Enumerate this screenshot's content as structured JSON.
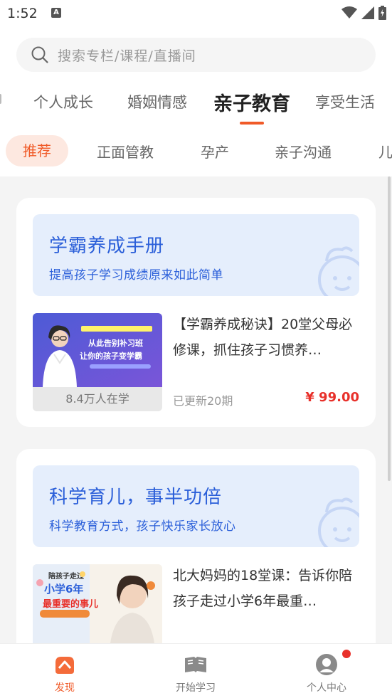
{
  "status_bar": {
    "time": "1:52",
    "indicator": "A"
  },
  "search": {
    "placeholder": "搜索专栏/课程/直播间"
  },
  "tabs": [
    {
      "label": "个人成长"
    },
    {
      "label": "婚姻情感"
    },
    {
      "label": "亲子教育"
    },
    {
      "label": "享受生活"
    }
  ],
  "subtabs": [
    {
      "label": "推荐"
    },
    {
      "label": "正面管教"
    },
    {
      "label": "孕产"
    },
    {
      "label": "亲子沟通"
    },
    {
      "label": "儿"
    }
  ],
  "cards": [
    {
      "banner_title": "学霸养成手册",
      "banner_subtitle": "提高孩子学习成绩原来如此简单",
      "course": {
        "title": "【学霸养成秘诀】20堂父母必修课，抓住孩子习惯养…",
        "learners": "8.4万人在学",
        "meta": "已更新20期",
        "price": "¥ 99.00",
        "thumb_headline": "从此告别补习班 让你的孩子变学霸"
      }
    },
    {
      "banner_title": "科学育儿，事半功倍",
      "banner_subtitle": "科学教育方式，孩子快乐家长放心",
      "course": {
        "title": "北大妈妈的18堂课：告诉你陪孩子走过小学6年最重…",
        "thumb_headline": "陪孩子走过 小学6年 最重要的事儿",
        "thumb_tag": "北大妈妈的18堂课"
      }
    }
  ],
  "bottom_nav": [
    {
      "label": "发现",
      "icon": "discover-icon",
      "active": true
    },
    {
      "label": "开始学习",
      "icon": "book-icon",
      "active": false
    },
    {
      "label": "个人中心",
      "icon": "profile-icon",
      "active": false
    }
  ],
  "colors": {
    "accent": "#f05a28",
    "price": "#e8312b",
    "banner_text": "#2b5fd9",
    "banner_bg": "#e5eefc"
  }
}
